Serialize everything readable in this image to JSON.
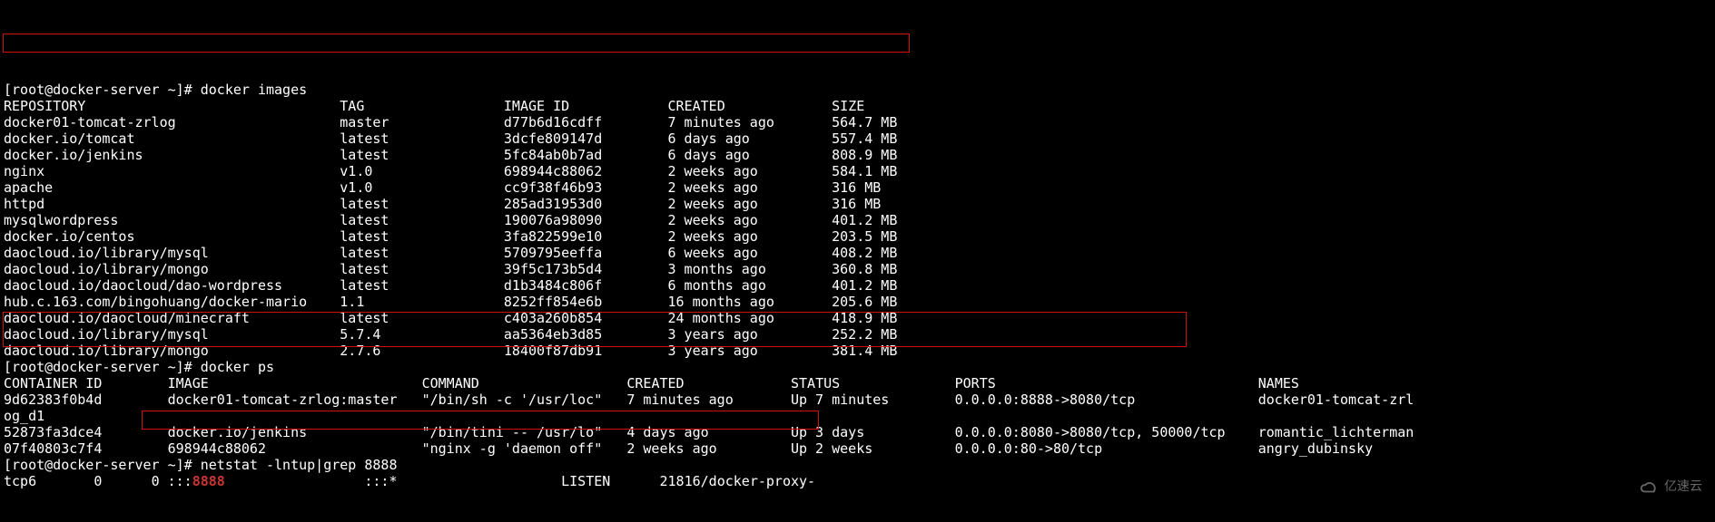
{
  "prompt_user": "root@docker-server",
  "prompt_path": "~",
  "cmd_images": "docker images",
  "images_header": {
    "repo": "REPOSITORY",
    "tag": "TAG",
    "id": "IMAGE ID",
    "created": "CREATED",
    "size": "SIZE"
  },
  "images": [
    {
      "repo": "docker01-tomcat-zrlog",
      "tag": "master",
      "id": "d77b6d16cdff",
      "created": "7 minutes ago",
      "size": "564.7 MB",
      "hl": true
    },
    {
      "repo": "docker.io/tomcat",
      "tag": "latest",
      "id": "3dcfe809147d",
      "created": "6 days ago",
      "size": "557.4 MB"
    },
    {
      "repo": "docker.io/jenkins",
      "tag": "latest",
      "id": "5fc84ab0b7ad",
      "created": "6 days ago",
      "size": "808.9 MB"
    },
    {
      "repo": "nginx",
      "tag": "v1.0",
      "id": "698944c88062",
      "created": "2 weeks ago",
      "size": "584.1 MB"
    },
    {
      "repo": "apache",
      "tag": "v1.0",
      "id": "cc9f38f46b93",
      "created": "2 weeks ago",
      "size": "316 MB"
    },
    {
      "repo": "httpd",
      "tag": "latest",
      "id": "285ad31953d0",
      "created": "2 weeks ago",
      "size": "316 MB"
    },
    {
      "repo": "mysqlwordpress",
      "tag": "latest",
      "id": "190076a98090",
      "created": "2 weeks ago",
      "size": "401.2 MB"
    },
    {
      "repo": "docker.io/centos",
      "tag": "latest",
      "id": "3fa822599e10",
      "created": "2 weeks ago",
      "size": "203.5 MB"
    },
    {
      "repo": "daocloud.io/library/mysql",
      "tag": "latest",
      "id": "5709795eeffa",
      "created": "6 weeks ago",
      "size": "408.2 MB"
    },
    {
      "repo": "daocloud.io/library/mongo",
      "tag": "latest",
      "id": "39f5c173b5d4",
      "created": "3 months ago",
      "size": "360.8 MB"
    },
    {
      "repo": "daocloud.io/daocloud/dao-wordpress",
      "tag": "latest",
      "id": "d1b3484c806f",
      "created": "6 months ago",
      "size": "401.2 MB"
    },
    {
      "repo": "hub.c.163.com/bingohuang/docker-mario",
      "tag": "1.1",
      "id": "8252ff854e6b",
      "created": "16 months ago",
      "size": "205.6 MB"
    },
    {
      "repo": "daocloud.io/daocloud/minecraft",
      "tag": "latest",
      "id": "c403a260b854",
      "created": "24 months ago",
      "size": "418.9 MB"
    },
    {
      "repo": "daocloud.io/library/mysql",
      "tag": "5.7.4",
      "id": "aa5364eb3d85",
      "created": "3 years ago",
      "size": "252.2 MB"
    },
    {
      "repo": "daocloud.io/library/mongo",
      "tag": "2.7.6",
      "id": "18400f87db91",
      "created": "3 years ago",
      "size": "381.4 MB"
    }
  ],
  "cmd_ps": "docker ps",
  "ps_header": {
    "id": "CONTAINER ID",
    "image": "IMAGE",
    "command": "COMMAND",
    "created": "CREATED",
    "status": "STATUS",
    "ports": "PORTS",
    "names": "NAMES"
  },
  "ps": [
    {
      "id": "9d62383f0b4d",
      "image": "docker01-tomcat-zrlog:master",
      "command": "\"/bin/sh -c '/usr/loc\"",
      "created": "7 minutes ago",
      "status": "Up 7 minutes",
      "ports": "0.0.0.0:8888->8080/tcp",
      "names": "docker01-tomcat-zrlog_d1",
      "hl": true
    },
    {
      "id": "52873fa3dce4",
      "image": "docker.io/jenkins",
      "command": "\"/bin/tini -- /usr/lo\"",
      "created": "4 days ago",
      "status": "Up 3 days",
      "ports": "0.0.0.0:8080->8080/tcp, 50000/tcp",
      "names": "romantic_lichterman"
    },
    {
      "id": "07f40803c7f4",
      "image": "698944c88062",
      "command": "\"nginx -g 'daemon off\"",
      "created": "2 weeks ago",
      "status": "Up 2 weeks",
      "ports": "0.0.0.0:80->80/tcp",
      "names": "angry_dubinsky"
    }
  ],
  "cmd_net": "netstat -lntup|grep 8888",
  "net": {
    "proto": "tcp6",
    "recvq": "0",
    "sendq": "0",
    "local": ":::",
    "port": "8888",
    "foreign": ":::*",
    "state": "LISTEN",
    "pid": "21816/docker-proxy-"
  },
  "watermark": "亿速云"
}
